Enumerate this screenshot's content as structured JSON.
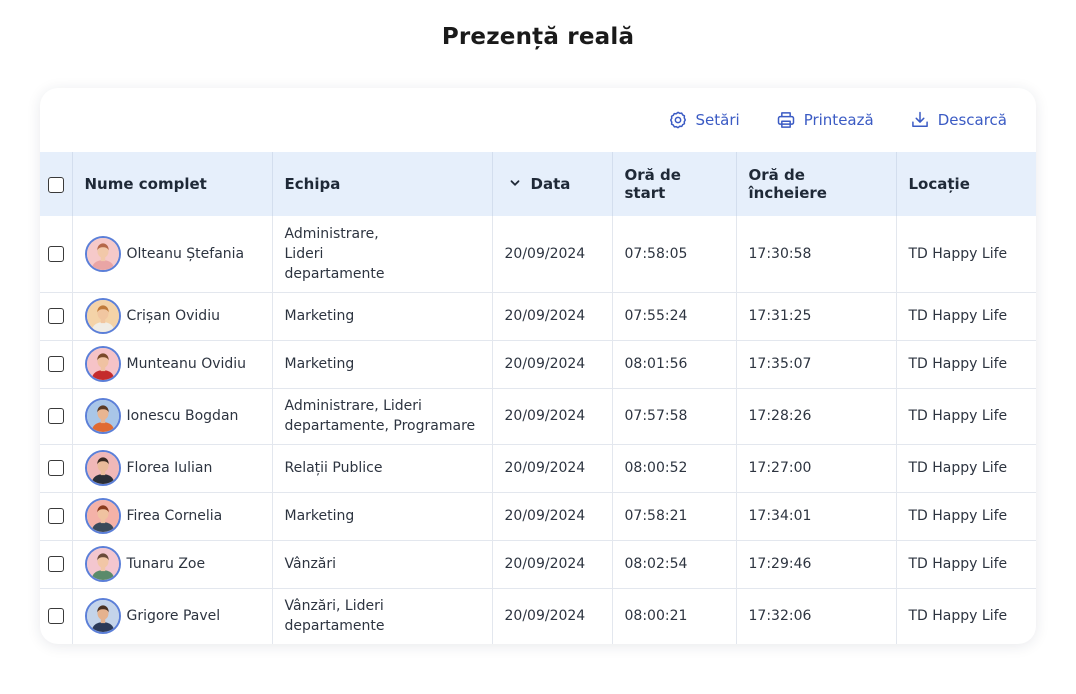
{
  "page": {
    "title": "Prezență reală"
  },
  "toolbar": {
    "settings_label": "Setări",
    "print_label": "Printează",
    "download_label": "Descarcă",
    "accent_color": "#3b5bc4"
  },
  "table": {
    "headers": {
      "name": "Nume complet",
      "team": "Echipa",
      "date": "Data",
      "start": "Oră de start",
      "end": "Oră de încheiere",
      "location": "Locație"
    },
    "sort": {
      "column": "date",
      "direction": "descending",
      "icon": "chevron-down-icon"
    },
    "rows": [
      {
        "name": "Olteanu Ștefania",
        "team": [
          "Administrare,",
          "Lideri",
          "departamente"
        ],
        "date": "20/09/2024",
        "start": "07:58:05",
        "end": "17:30:58",
        "location": "TD Happy Life",
        "avatar": {
          "bg": "#f6c9c9",
          "hair": "#b5684a",
          "shirt": "#e9a5a5",
          "skin": "#f2c8a9"
        }
      },
      {
        "name": "Crișan Ovidiu",
        "team": [
          "Marketing"
        ],
        "date": "20/09/2024",
        "start": "07:55:24",
        "end": "17:31:25",
        "location": "TD Happy Life",
        "avatar": {
          "bg": "#f4d3a8",
          "hair": "#c07a3a",
          "shirt": "#f0ede6",
          "skin": "#f1c6a0"
        }
      },
      {
        "name": "Munteanu Ovidiu",
        "team": [
          "Marketing"
        ],
        "date": "20/09/2024",
        "start": "08:01:56",
        "end": "17:35:07",
        "location": "TD Happy Life",
        "avatar": {
          "bg": "#f6c3c7",
          "hair": "#7a4a2a",
          "shirt": "#c42c2c",
          "skin": "#f0c2a2"
        }
      },
      {
        "name": "Ionescu Bogdan",
        "team": [
          "Administrare, Lideri",
          "departamente, Programare"
        ],
        "date": "20/09/2024",
        "start": "07:57:58",
        "end": "17:28:26",
        "location": "TD Happy Life",
        "avatar": {
          "bg": "#a9c6e8",
          "hair": "#5a3a24",
          "shirt": "#e06a32",
          "skin": "#e8b592"
        }
      },
      {
        "name": "Florea Iulian",
        "team": [
          "Relații Publice"
        ],
        "date": "20/09/2024",
        "start": "08:00:52",
        "end": "17:27:00",
        "location": "TD Happy Life",
        "avatar": {
          "bg": "#f0b8b8",
          "hair": "#3a2a22",
          "shirt": "#2b2f38",
          "skin": "#eabb9a"
        }
      },
      {
        "name": "Firea Cornelia",
        "team": [
          "Marketing"
        ],
        "date": "20/09/2024",
        "start": "07:58:21",
        "end": "17:34:01",
        "location": "TD Happy Life",
        "avatar": {
          "bg": "#f4b2a8",
          "hair": "#8a3a1e",
          "shirt": "#3a4a5a",
          "skin": "#f0c2a0"
        }
      },
      {
        "name": "Tunaru Zoe",
        "team": [
          "Vânzări"
        ],
        "date": "20/09/2024",
        "start": "08:02:54",
        "end": "17:29:46",
        "location": "TD Happy Life",
        "avatar": {
          "bg": "#f3c6cf",
          "hair": "#6a4a3a",
          "shirt": "#5a8a6a",
          "skin": "#f2c6a6"
        }
      },
      {
        "name": "Grigore Pavel",
        "team": [
          "Vânzări, Lideri",
          "departamente"
        ],
        "date": "20/09/2024",
        "start": "08:00:21",
        "end": "17:32:06",
        "location": "TD Happy Life",
        "avatar": {
          "bg": "#c4d4ea",
          "hair": "#4a3222",
          "shirt": "#2c3a58",
          "skin": "#e5b28e"
        }
      }
    ]
  }
}
